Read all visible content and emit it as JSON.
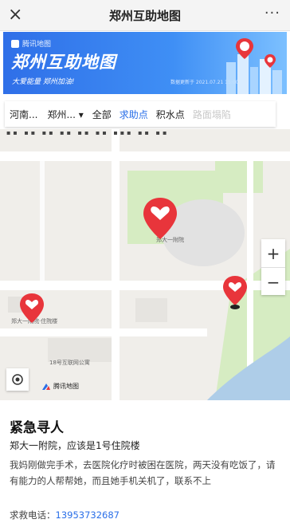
{
  "topbar": {
    "close_icon": "×",
    "title": "郑州互助地图",
    "more_icon": "···"
  },
  "banner": {
    "brand_small": "腾讯地图",
    "title": "郑州互助地图",
    "tagline": "大爱能量 郑州加油!",
    "update_text": "数据更新于 2021.07.21 15:00"
  },
  "filters": {
    "province": "河南...",
    "city": "郑州...",
    "city_caret": "▾",
    "options": [
      "全部",
      "求助点",
      "积水点",
      "路面塌陷"
    ],
    "active_option": "求助点"
  },
  "map": {
    "scale_top": "▪▪ ▪▪ ▪▪  ▪▪ ▪▪ ▪▪  ▪▪▪ ▪▪ ▪▪",
    "poi_labels": [
      "郑大一附院·住院楼",
      "郑大一附院",
      "18号互联网公寓"
    ],
    "zoom_in": "+",
    "zoom_out": "−",
    "provider": "腾讯地图"
  },
  "info": {
    "heading": "紧急寻人",
    "location": "郑大一附院，应该是1号住院楼",
    "description": "我妈刚做完手术，去医院化疗时被困在医院，两天没有吃饭了，请有能力的人帮帮她，而且她手机关机了，联系不上",
    "phone_label": "求救电话：",
    "phone_number": "13953732687"
  },
  "colors": {
    "accent": "#2a6fe8",
    "marker_red": "#e8353b",
    "banner_blue": "#3a86f0"
  }
}
